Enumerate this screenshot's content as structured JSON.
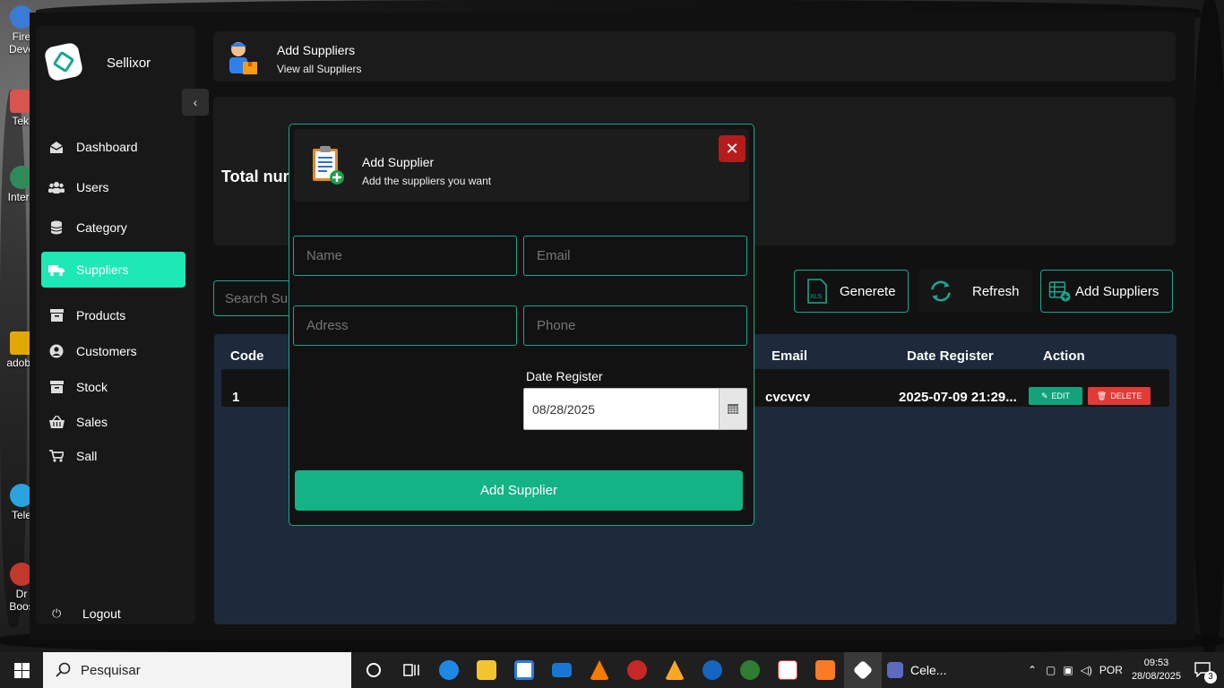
{
  "desktop": {
    "icons": [
      {
        "label": "Fire Deve"
      },
      {
        "label": "Tekl"
      },
      {
        "label": "Intern"
      },
      {
        "label": "adoba"
      },
      {
        "label": "Tele"
      },
      {
        "label": "Dr Boos"
      }
    ]
  },
  "sidebar": {
    "brand": "Sellixor",
    "collapse_glyph": "‹",
    "items": [
      {
        "label": "Dashboard",
        "icon": "envelope-open-icon"
      },
      {
        "label": "Users",
        "icon": "users-icon"
      },
      {
        "label": "Category",
        "icon": "database-icon"
      },
      {
        "label": "Suppliers",
        "icon": "truck-icon"
      },
      {
        "label": "Products",
        "icon": "box-icon"
      },
      {
        "label": "Customers",
        "icon": "user-circle-icon"
      },
      {
        "label": "Stock",
        "icon": "archive-icon"
      },
      {
        "label": "Sales",
        "icon": "basket-icon"
      },
      {
        "label": "Sall",
        "icon": "cart-icon"
      }
    ],
    "logout": "Logout",
    "active_color": "#1de9b6"
  },
  "header": {
    "title": "Add Suppliers",
    "subtitle": "View all Suppliers"
  },
  "summary": {
    "label": "Total num"
  },
  "toolbar": {
    "search_placeholder": "Search Sup",
    "generate": "Generete",
    "refresh": "Refresh",
    "add": "Add Suppliers"
  },
  "table": {
    "columns": {
      "code": "Code",
      "email": "Email",
      "date": "Date Register",
      "action": "Action"
    },
    "rows": [
      {
        "code": "1",
        "email": "cvcvcv",
        "date": "2025-07-09 21:29...",
        "edit": "EDIT",
        "delete": "DELETE"
      }
    ]
  },
  "modal": {
    "title": "Add Supplier",
    "subtitle": "Add the suppliers you want",
    "close_glyph": "✕",
    "fields": {
      "name": "Name",
      "email": "Email",
      "address": "Adress",
      "phone": "Phone"
    },
    "date_label": "Date Register",
    "date_value": "08/28/2025",
    "submit": "Add Supplier"
  },
  "taskbar": {
    "search": "Pesquisar",
    "running_app": "Cele...",
    "language": "POR",
    "time": "09:53",
    "date": "28/08/2025",
    "notifications": "3"
  },
  "colors": {
    "accent": "#1aa68c",
    "submit": "#13b385",
    "danger": "#e53935",
    "table_bg": "#1d2a3b"
  }
}
